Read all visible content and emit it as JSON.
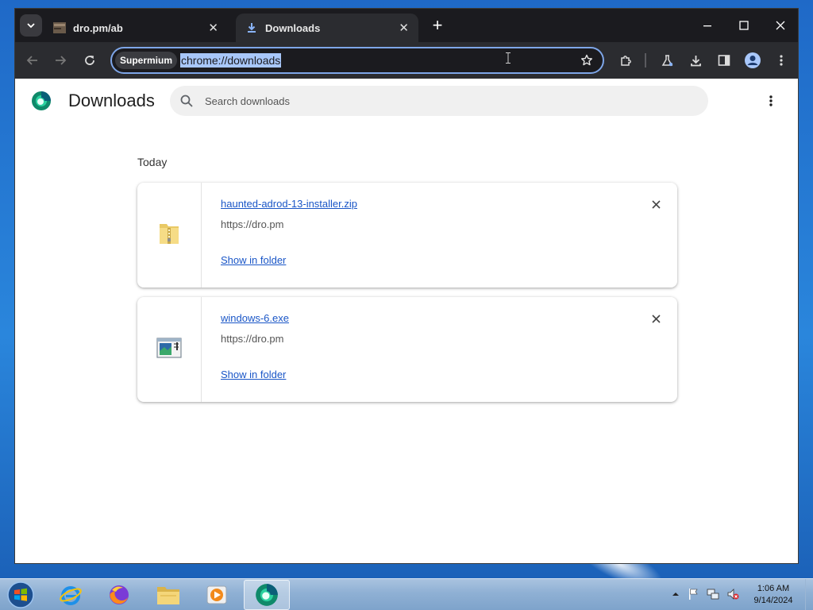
{
  "browser": {
    "tabs": [
      {
        "title": "dro.pm/ab",
        "active": false
      },
      {
        "title": "Downloads",
        "active": true
      }
    ],
    "omnibox": {
      "chip": "Supermium",
      "url": "chrome://downloads"
    }
  },
  "page": {
    "title": "Downloads",
    "search_placeholder": "Search downloads",
    "section_label": "Today",
    "downloads": [
      {
        "file_name": "haunted-adrod-13-installer.zip",
        "source_url": "https://dro.pm",
        "action_label": "Show in folder",
        "icon": "zip-folder-icon"
      },
      {
        "file_name": "windows-6.exe",
        "source_url": "https://dro.pm",
        "action_label": "Show in folder",
        "icon": "exe-file-icon"
      }
    ]
  },
  "taskbar": {
    "apps": [
      "start-orb",
      "internet-explorer",
      "firefox",
      "file-explorer",
      "media-player",
      "supermium"
    ],
    "clock": {
      "time": "1:06 AM",
      "date": "9/14/2024"
    }
  },
  "colors": {
    "link": "#1a56c7",
    "tabstrip": "#1b1b1f",
    "toolbar": "#2b2c30",
    "omnibox_border": "#7ea6e8",
    "url_selection": "#a8c7fa"
  }
}
